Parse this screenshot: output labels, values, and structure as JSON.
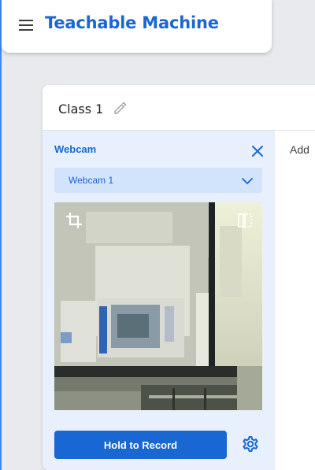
{
  "app": {
    "title": "Teachable Machine",
    "brand_color": "#1967d2"
  },
  "header": {
    "menu_icon": "menu-icon"
  },
  "class_card": {
    "name": "Class 1",
    "edit_icon": "pencil-icon"
  },
  "webcam_panel": {
    "label": "Webcam",
    "close_icon": "close-icon",
    "device_select": {
      "value": "Webcam 1",
      "icon": "chevron-down-icon"
    },
    "preview": {
      "crop_icon": "crop-icon",
      "flip_icon": "flip-icon"
    },
    "record_button": "Hold to Record",
    "settings_icon": "gear-icon"
  },
  "samples": {
    "label": "Add"
  }
}
